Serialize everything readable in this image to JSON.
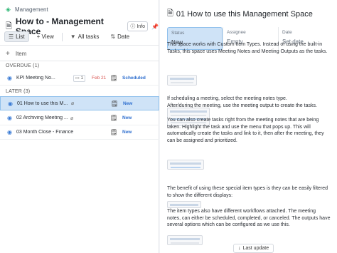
{
  "breadcrumb": {
    "label": "Management"
  },
  "page": {
    "title": "How to - Management Space",
    "info_label": "Info"
  },
  "toolbar": {
    "list_label": "List",
    "view_label": "+ View",
    "all_tasks_label": "All tasks",
    "date_label": "Date"
  },
  "list": {
    "add_item_label": "Item",
    "groups": [
      {
        "title": "OVERDUE (1)",
        "rows": [
          {
            "name": "KPI Meeting No...",
            "count": "1",
            "date": "Feb 21",
            "status": "Scheduled"
          }
        ]
      },
      {
        "title": "LATER (3)",
        "rows": [
          {
            "name": "01 How to use this M...",
            "status": "New"
          },
          {
            "name": "02 Archiving Meeting ...",
            "status": "New"
          },
          {
            "name": "03 Month Close - Finance",
            "status": "New"
          }
        ]
      }
    ]
  },
  "detail": {
    "title": "01 How to use this Management Space",
    "props": [
      {
        "label": "Status",
        "value": "New"
      },
      {
        "label": "Assignee",
        "value": "Empty"
      },
      {
        "label": "Date",
        "value": "Set date"
      }
    ],
    "paragraphs": [
      "This space works with Custom Item Types. Instead of using the built-in Tasks, this space uses Meeting Notes and Meeting Outputs as the tasks.",
      "If scheduling a meeting, select the meeting notes type.\nAfter/during the meeting, use the meeting output to create the tasks.",
      "You can also create tasks right from the meeting notes that are being taken. Highlight the task and use the menu that pops up. This will automatically create the tasks and link to it, then after the meeting, they can be assigned and prioritized.",
      "The benefit of using these special item types is they can be easily filtered to show the different displays:",
      "The item types also have different workflows attached. The meeting notes, can either be scheduled, completed, or canceled. The outputs have several options which can be configured as we use this."
    ],
    "last_update_label": "Last update"
  },
  "colors": {
    "accent": "#2f6fcf",
    "selected": "#cfe3f7",
    "overdue": "#d9534f"
  }
}
